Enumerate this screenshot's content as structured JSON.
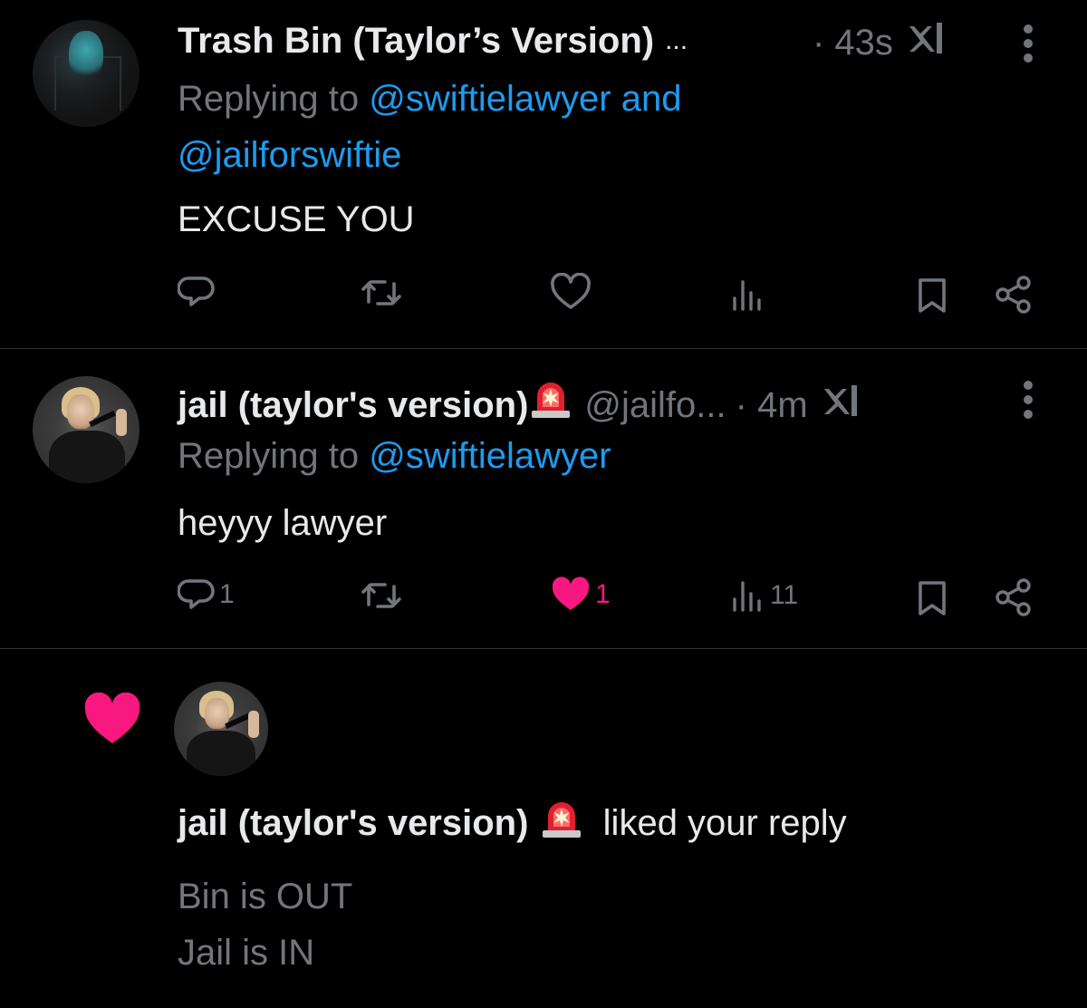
{
  "colors": {
    "background": "#000000",
    "text_primary": "#e7e9ea",
    "text_secondary": "#71767b",
    "link": "#1d9bf0",
    "like": "#f91880",
    "divider": "#2f3336"
  },
  "tweets": [
    {
      "display_name": "Trash Bin (Taylor’s Version)",
      "name_truncation": "...",
      "handle": "",
      "time": "· 43s",
      "replying_prefix": "Replying to",
      "mentions": [
        "@swiftielawyer",
        "@jailforswiftie"
      ],
      "mention_joiner": "and",
      "text": "EXCUSE YOU",
      "actions": {
        "reply_count": "",
        "retweet_count": "",
        "like_count": "",
        "view_count": ""
      },
      "avatar_icon": "profile-avatar",
      "liked": false
    },
    {
      "display_name": "jail (taylor's version)",
      "name_truncation": "",
      "handle": "@jailfo...",
      "time": "· 4m",
      "replying_prefix": "Replying to",
      "mentions": [
        "@swiftielawyer"
      ],
      "mention_joiner": "",
      "text": "heyyy lawyer",
      "actions": {
        "reply_count": "1",
        "retweet_count": "",
        "like_count": "1",
        "view_count": "11"
      },
      "avatar_icon": "profile-avatar",
      "liked": true
    }
  ],
  "notification": {
    "icon": "heart-icon",
    "display_name": "jail (taylor's version)",
    "action_text": "liked your reply",
    "snippet_lines": [
      "Bin is OUT",
      "Jail is IN"
    ]
  },
  "icons": {
    "name_emoji": "police-light-emoji",
    "grok": "grok-icon",
    "more": "more-options-icon",
    "reply": "reply-icon",
    "retweet": "retweet-icon",
    "like": "heart-icon",
    "views": "views-icon",
    "bookmark": "bookmark-icon",
    "share": "share-icon"
  }
}
